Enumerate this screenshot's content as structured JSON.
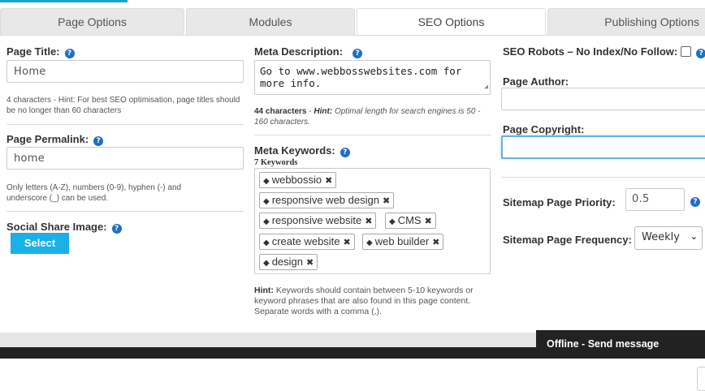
{
  "tabs": [
    {
      "label": "Page Options"
    },
    {
      "label": "Modules"
    },
    {
      "label": "SEO Options"
    },
    {
      "label": "Publishing Options"
    }
  ],
  "active_tab": "SEO Options",
  "left": {
    "page_title_label": "Page Title:",
    "page_title_value": "Home",
    "page_title_hint": "4 characters - Hint: For best SEO optimisation, page titles should be no longer than 60 characters",
    "permalink_label": "Page Permalink:",
    "permalink_value": "home",
    "permalink_hint": "Only letters (A-Z), numbers (0-9), hyphen (-) and underscore (_) can be used.",
    "social_label": "Social Share Image:",
    "select_button": "Select"
  },
  "middle": {
    "meta_desc_label": "Meta Description:",
    "meta_desc_value": "Go to www.webbosswebsites.com for more info.",
    "meta_desc_count": "44 characters",
    "meta_desc_sep": "-",
    "meta_desc_hint_label": "Hint:",
    "meta_desc_hint": "Optimal length for search engines is 50 - 160 characters.",
    "keywords_label": "Meta Keywords:",
    "keywords_count": "7 Keywords",
    "keywords": [
      "webbossio",
      "responsive web design",
      "responsive website",
      "CMS",
      "create website",
      "web builder",
      "design"
    ],
    "keywords_hint_label": "Hint:",
    "keywords_hint": "Keywords should contain between 5-10 keywords or keyword phrases that are also found in this page content. Separate words with a comma (,)."
  },
  "right": {
    "robots_label": "SEO Robots – No Index/No Follow:",
    "robots_checked": false,
    "author_label": "Page Author:",
    "author_value": "",
    "copyright_label": "Page Copyright:",
    "copyright_value": "",
    "priority_label": "Sitemap Page Priority:",
    "priority_value": "0.5",
    "frequency_label": "Sitemap Page Frequency:",
    "frequency_value": "Weekly"
  },
  "chat": {
    "label": "Offline - Send message"
  },
  "icons": {
    "help": "help-circle-icon",
    "tag": "tag-icon",
    "remove": "close-icon",
    "dropdown": "chevron-down-icon"
  },
  "colors": {
    "accent": "#1ab0e8",
    "help": "#1f6fc5",
    "footer": "#222222"
  }
}
